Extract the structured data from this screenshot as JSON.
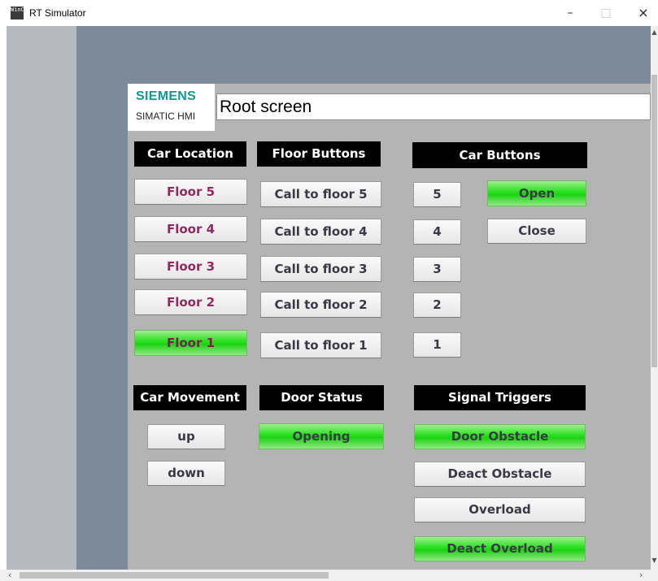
{
  "window": {
    "title": "RT Simulator",
    "icon_text": "WinCC",
    "controls": {
      "minimize": "–",
      "maximize": "□",
      "close": "×"
    }
  },
  "logo": {
    "brand": "SIEMENS",
    "product": "SIMATIC HMI"
  },
  "screen_title": "Root screen",
  "car_location": {
    "header": "Car Location",
    "floors": [
      {
        "label": "Floor 5",
        "active": false
      },
      {
        "label": "Floor 4",
        "active": false
      },
      {
        "label": "Floor 3",
        "active": false
      },
      {
        "label": "Floor 2",
        "active": false
      },
      {
        "label": "Floor 1",
        "active": true
      }
    ]
  },
  "floor_buttons": {
    "header": "Floor Buttons",
    "items": [
      "Call to floor 5",
      "Call to floor 4",
      "Call to floor 3",
      "Call to floor 2",
      "Call to floor 1"
    ]
  },
  "car_buttons": {
    "header": "Car Buttons",
    "numbers": [
      "5",
      "4",
      "3",
      "2",
      "1"
    ],
    "open_label": "Open",
    "open_active": true,
    "close_label": "Close"
  },
  "car_movement": {
    "header": "Car Movement",
    "up_label": "up",
    "down_label": "down"
  },
  "door_status": {
    "header": "Door Status",
    "value": "Opening",
    "active": true
  },
  "signal_triggers": {
    "header": "Signal Triggers",
    "items": [
      {
        "label": "Door Obstacle",
        "active": true
      },
      {
        "label": "Deact Obstacle",
        "active": false
      },
      {
        "label": "Overload",
        "active": false
      },
      {
        "label": "Deact Overload",
        "active": true
      }
    ]
  },
  "colors": {
    "active_green": "#24e11a",
    "header_black": "#000000",
    "floor_text": "#8e2a5e",
    "siemens_teal": "#129696",
    "hmi_background": "#b4b4b4",
    "outer_blue": "#7c8a99"
  }
}
